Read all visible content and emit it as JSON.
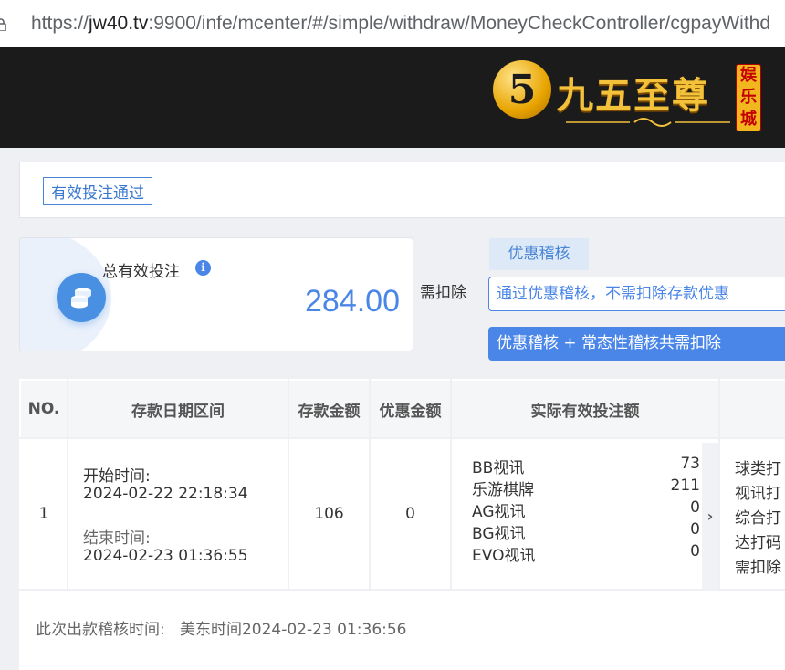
{
  "browser": {
    "url_scheme": "https://",
    "url_host": "jw40.tv",
    "url_rest": ":9900/infe/mcenter/#/simple/withdraw/MoneyCheckController/cgpayWithd"
  },
  "brand": {
    "logo_mark": "5",
    "logo_text": "九五至尊",
    "badge": [
      "娱",
      "乐",
      "城"
    ]
  },
  "status": {
    "tag": "有效投注通过"
  },
  "summary": {
    "label": "总有效投注",
    "info_icon": "i",
    "value": "284.00"
  },
  "deduction": {
    "label": "需扣除",
    "promo_tab": "优惠稽核",
    "promo_input": "通过优惠稽核，不需扣除存款优惠",
    "promo_button": "优惠稽核 + 常态性稽核共需扣除"
  },
  "table": {
    "headers": [
      "NO.",
      "存款日期区间",
      "存款金额",
      "优惠金额",
      "实际有效投注额"
    ],
    "row": {
      "no": "1",
      "start_label": "开始时间:",
      "start_time": "2024-02-22 22:18:34",
      "end_label": "结束时间:",
      "end_time": "2024-02-23 01:36:55",
      "deposit": "106",
      "promo": "0",
      "bets": [
        {
          "name": "BB视讯",
          "amount": "73"
        },
        {
          "name": "乐游棋牌",
          "amount": "211"
        },
        {
          "name": "AG视讯",
          "amount": "0"
        },
        {
          "name": "BG视讯",
          "amount": "0"
        },
        {
          "name": "EVO视讯",
          "amount": "0"
        }
      ],
      "scroll_arrow": "›",
      "extra": [
        "球类打",
        "视讯打",
        "综合打",
        "达打码",
        "需扣除"
      ]
    }
  },
  "footer": {
    "label": "此次出款稽核时间:",
    "time": "美东时间2024-02-23 01:36:56"
  },
  "colors": {
    "accent": "#4a86e8",
    "header_bg": "#1b1b1b",
    "gold": "#f3c13a"
  }
}
